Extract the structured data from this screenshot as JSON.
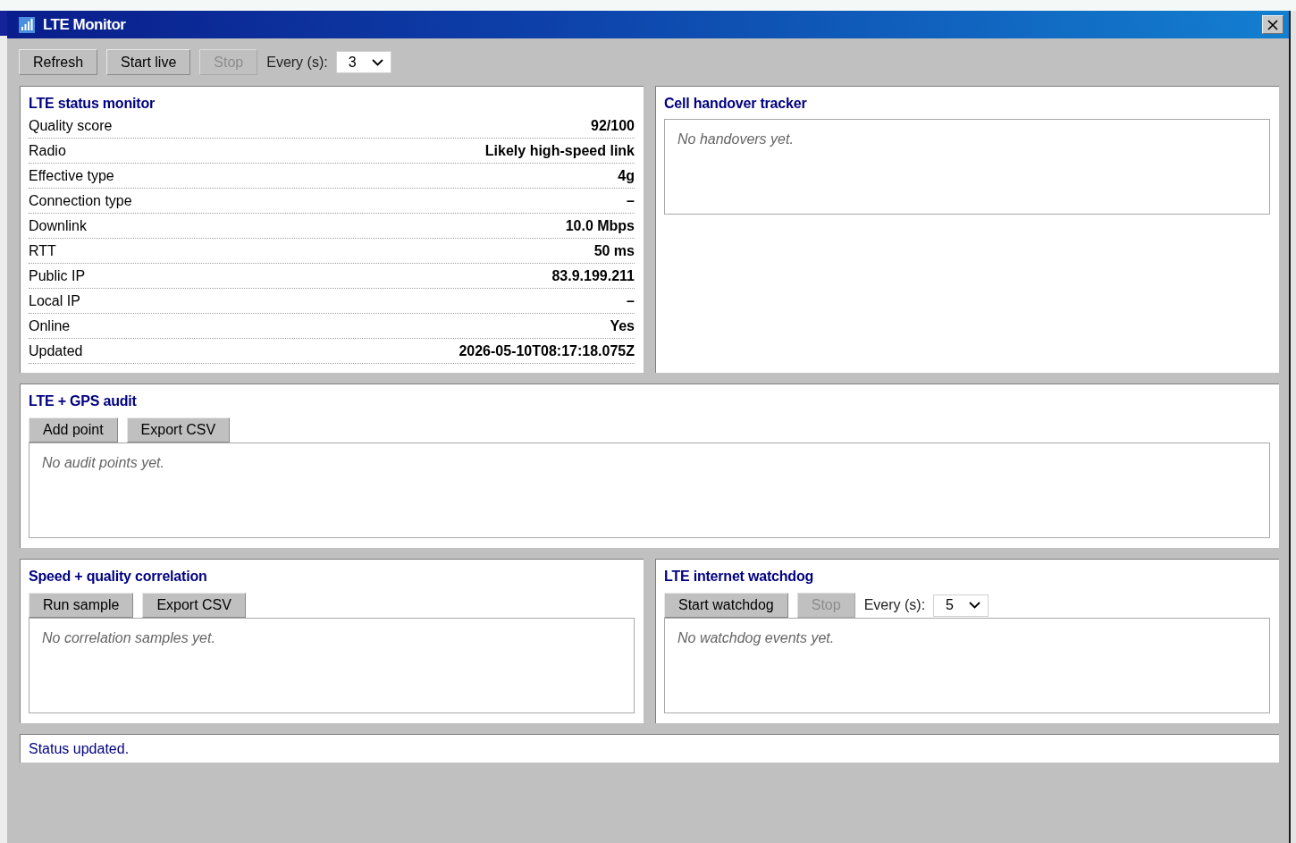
{
  "window": {
    "title": "LTE Monitor"
  },
  "toolbar": {
    "buttons": [
      {
        "label": "Refresh",
        "disabled": false
      },
      {
        "label": "Start live",
        "disabled": false
      },
      {
        "label": "Stop",
        "disabled": true
      }
    ],
    "interval": {
      "label": "Every (s):",
      "value": "3"
    }
  },
  "status_monitor": {
    "title": "LTE status monitor",
    "rows": [
      {
        "label": "Quality score",
        "value": "92/100"
      },
      {
        "label": "Radio",
        "value": "Likely high-speed link"
      },
      {
        "label": "Effective type",
        "value": "4g"
      },
      {
        "label": "Connection type",
        "value": "–"
      },
      {
        "label": "Downlink",
        "value": "10.0 Mbps"
      },
      {
        "label": "RTT",
        "value": "50 ms"
      },
      {
        "label": "Public IP",
        "value": "83.9.199.211"
      },
      {
        "label": "Local IP",
        "value": "–"
      },
      {
        "label": "Online",
        "value": "Yes"
      },
      {
        "label": "Updated",
        "value": "2026-05-10T08:17:18.075Z"
      }
    ]
  },
  "handover_tracker": {
    "title": "Cell handover tracker",
    "empty_text": "No handovers yet."
  },
  "gps_audit": {
    "title": "LTE + GPS audit",
    "buttons": [
      {
        "label": "Add point",
        "disabled": false
      },
      {
        "label": "Export CSV",
        "disabled": false
      }
    ],
    "empty_text": "No audit points yet."
  },
  "correlation": {
    "title": "Speed + quality correlation",
    "buttons": [
      {
        "label": "Run sample",
        "disabled": false
      },
      {
        "label": "Export CSV",
        "disabled": false
      }
    ],
    "empty_text": "No correlation samples yet."
  },
  "watchdog": {
    "title": "LTE internet watchdog",
    "buttons": [
      {
        "label": "Start watchdog",
        "disabled": false
      },
      {
        "label": "Stop",
        "disabled": true
      }
    ],
    "interval": {
      "label": "Every (s):",
      "value": "5"
    },
    "empty_text": "No watchdog events yet."
  },
  "status_bar": {
    "text": "Status updated."
  }
}
